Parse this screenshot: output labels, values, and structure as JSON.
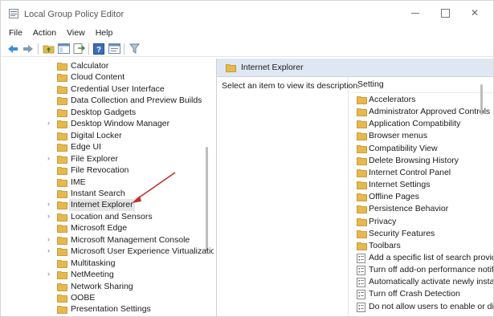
{
  "window": {
    "title": "Local Group Policy Editor"
  },
  "menu": [
    "File",
    "Action",
    "View",
    "Help"
  ],
  "toolbar": {
    "buttons": [
      "back-icon",
      "forward-icon",
      "up-folder-icon",
      "show-hide-tree-icon",
      "export-list-icon",
      "help-icon",
      "properties-icon",
      "filter-icon"
    ]
  },
  "tree": {
    "items": [
      {
        "label": "Calculator",
        "expandable": false,
        "selected": false
      },
      {
        "label": "Cloud Content",
        "expandable": false,
        "selected": false
      },
      {
        "label": "Credential User Interface",
        "expandable": false,
        "selected": false
      },
      {
        "label": "Data Collection and Preview Builds",
        "expandable": false,
        "selected": false
      },
      {
        "label": "Desktop Gadgets",
        "expandable": false,
        "selected": false
      },
      {
        "label": "Desktop Window Manager",
        "expandable": true,
        "selected": false
      },
      {
        "label": "Digital Locker",
        "expandable": false,
        "selected": false
      },
      {
        "label": "Edge UI",
        "expandable": false,
        "selected": false
      },
      {
        "label": "File Explorer",
        "expandable": true,
        "selected": false
      },
      {
        "label": "File Revocation",
        "expandable": false,
        "selected": false
      },
      {
        "label": "IME",
        "expandable": false,
        "selected": false
      },
      {
        "label": "Instant Search",
        "expandable": false,
        "selected": false
      },
      {
        "label": "Internet Explorer",
        "expandable": true,
        "selected": true
      },
      {
        "label": "Location and Sensors",
        "expandable": true,
        "selected": false
      },
      {
        "label": "Microsoft Edge",
        "expandable": false,
        "selected": false
      },
      {
        "label": "Microsoft Management Console",
        "expandable": true,
        "selected": false
      },
      {
        "label": "Microsoft User Experience Virtualization",
        "expandable": true,
        "selected": false
      },
      {
        "label": "Multitasking",
        "expandable": false,
        "selected": false
      },
      {
        "label": "NetMeeting",
        "expandable": true,
        "selected": false
      },
      {
        "label": "Network Sharing",
        "expandable": false,
        "selected": false
      },
      {
        "label": "OOBE",
        "expandable": false,
        "selected": false
      },
      {
        "label": "Presentation Settings",
        "expandable": false,
        "selected": false
      }
    ]
  },
  "right_pane": {
    "header_title": "Internet Explorer",
    "description": "Select an item to view its description.",
    "column_header": "Setting",
    "settings": [
      {
        "label": "Accelerators",
        "type": "folder"
      },
      {
        "label": "Administrator Approved Controls",
        "type": "folder"
      },
      {
        "label": "Application Compatibility",
        "type": "folder"
      },
      {
        "label": "Browser menus",
        "type": "folder"
      },
      {
        "label": "Compatibility View",
        "type": "folder"
      },
      {
        "label": "Delete Browsing History",
        "type": "folder"
      },
      {
        "label": "Internet Control Panel",
        "type": "folder"
      },
      {
        "label": "Internet Settings",
        "type": "folder"
      },
      {
        "label": "Offline Pages",
        "type": "folder"
      },
      {
        "label": "Persistence Behavior",
        "type": "folder"
      },
      {
        "label": "Privacy",
        "type": "folder"
      },
      {
        "label": "Security Features",
        "type": "folder"
      },
      {
        "label": "Toolbars",
        "type": "folder"
      },
      {
        "label": "Add a specific list of search providers",
        "type": "policy"
      },
      {
        "label": "Turn off add-on performance notifications",
        "type": "policy"
      },
      {
        "label": "Automatically activate newly installed add-ons",
        "type": "policy"
      },
      {
        "label": "Turn off Crash Detection",
        "type": "policy"
      },
      {
        "label": "Do not allow users to enable or disable add-ons",
        "type": "policy"
      }
    ]
  },
  "colors": {
    "folder": "#e8b84a",
    "header_bg": "#dfe7f2",
    "arrow": "#c0302b",
    "selection": "#e6e6e6"
  }
}
